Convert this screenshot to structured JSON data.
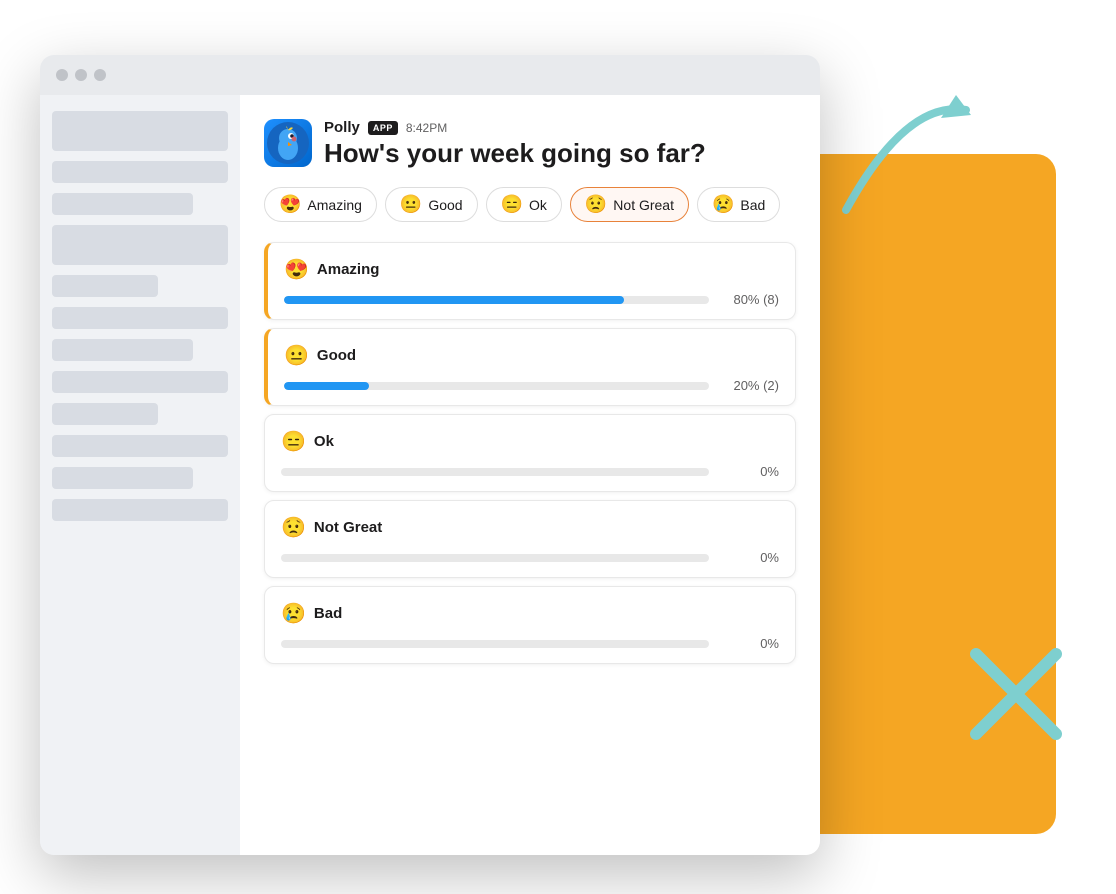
{
  "background": {
    "color": "#F5A623"
  },
  "browser": {
    "titlebar": {
      "dots": [
        "dot1",
        "dot2",
        "dot3"
      ]
    }
  },
  "sidebar": {
    "items": [
      {
        "width": "wide",
        "height": "tall"
      },
      {
        "width": "wide"
      },
      {
        "width": "medium"
      },
      {
        "width": "wide",
        "height": "tall"
      },
      {
        "width": "short"
      },
      {
        "width": "wide"
      },
      {
        "width": "medium"
      },
      {
        "width": "wide"
      },
      {
        "width": "short"
      },
      {
        "width": "wide"
      },
      {
        "width": "medium"
      },
      {
        "width": "wide"
      }
    ]
  },
  "message": {
    "sender": "Polly",
    "app_badge": "APP",
    "time": "8:42PM",
    "question": "How's your week going so far?"
  },
  "poll_options": [
    {
      "emoji": "😍",
      "label": "Amazing",
      "selected": false
    },
    {
      "emoji": "😐",
      "label": "Good",
      "selected": false
    },
    {
      "emoji": "😑",
      "label": "Ok",
      "selected": false
    },
    {
      "emoji": "😟",
      "label": "Not Great",
      "selected": true
    },
    {
      "emoji": "😢",
      "label": "Bad",
      "selected": false
    }
  ],
  "results": [
    {
      "emoji": "😍",
      "label": "Amazing",
      "pct": 80,
      "pct_label": "80% (8)"
    },
    {
      "emoji": "😐",
      "label": "Good",
      "pct": 20,
      "pct_label": "20% (2)"
    },
    {
      "emoji": "😑",
      "label": "Ok",
      "pct": 0,
      "pct_label": "0%"
    },
    {
      "emoji": "😟",
      "label": "Not Great",
      "pct": 0,
      "pct_label": "0%"
    },
    {
      "emoji": "😢",
      "label": "Bad",
      "pct": 0,
      "pct_label": "0%"
    }
  ]
}
